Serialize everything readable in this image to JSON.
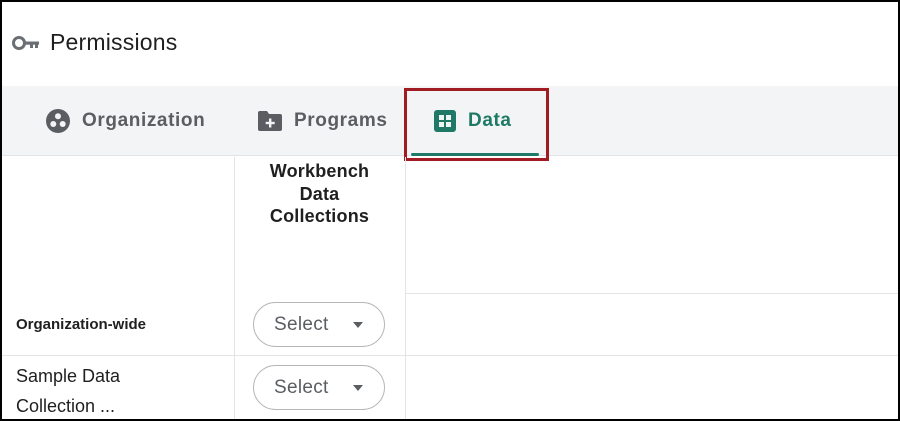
{
  "header": {
    "title": "Permissions",
    "icon": "key-icon"
  },
  "tabs": [
    {
      "label": "Organization",
      "icon": "organization-icon",
      "active": false
    },
    {
      "label": "Programs",
      "icon": "folder-plus-icon",
      "active": false
    },
    {
      "label": "Data",
      "icon": "grid-icon",
      "active": true
    }
  ],
  "colors": {
    "accent": "#1e7a67",
    "highlight_border": "#a01b22",
    "tab_bar_bg": "#f3f4f5"
  },
  "table": {
    "column_header_lines": [
      "Workbench",
      "Data",
      "Collections"
    ],
    "rows": [
      {
        "label": "Organization-wide",
        "select_value": "Select"
      },
      {
        "label_lines": [
          "Sample Data",
          "Collection ..."
        ],
        "select_value": "Select"
      }
    ]
  }
}
